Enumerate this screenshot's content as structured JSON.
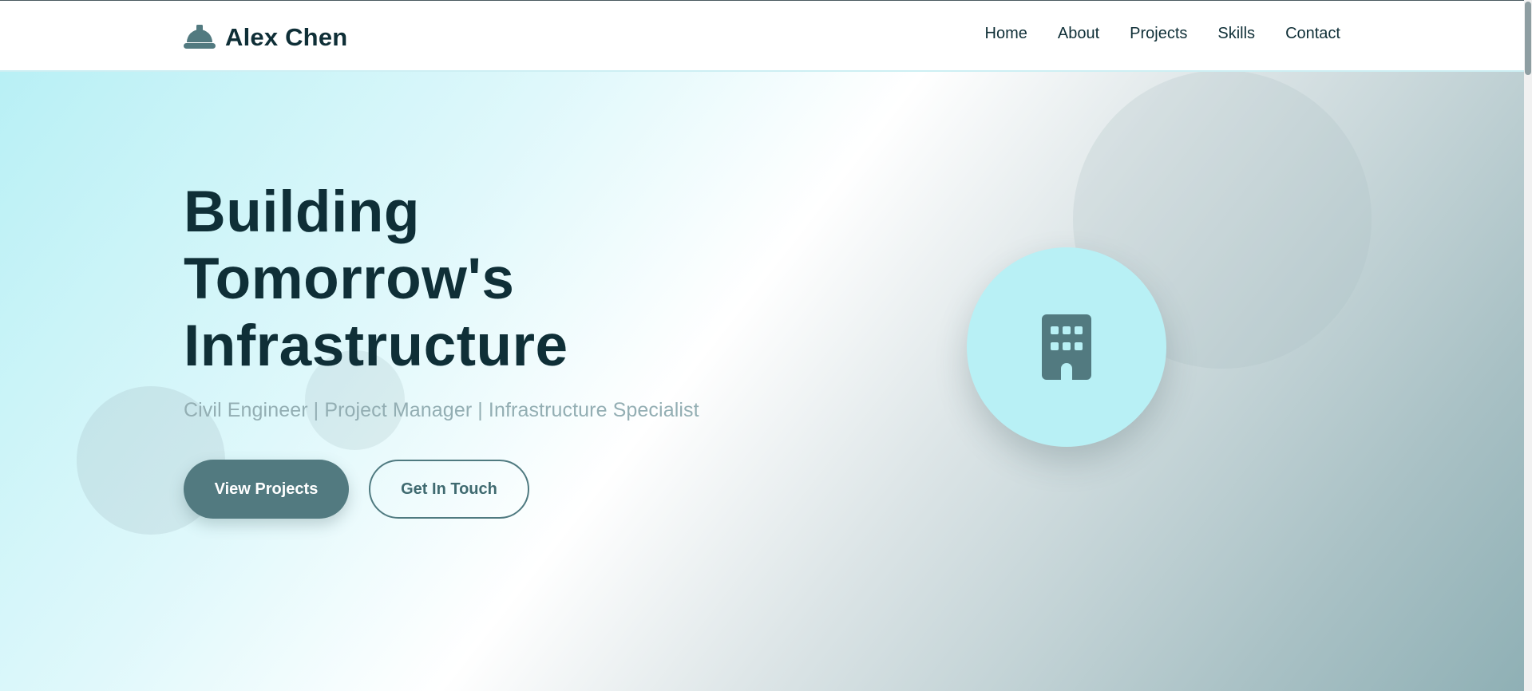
{
  "brand": {
    "name": "Alex Chen",
    "icon": "hard-hat-icon"
  },
  "nav": {
    "items": [
      {
        "label": "Home"
      },
      {
        "label": "About"
      },
      {
        "label": "Projects"
      },
      {
        "label": "Skills"
      },
      {
        "label": "Contact"
      }
    ]
  },
  "hero": {
    "title_lines": [
      "Building",
      "Tomorrow's",
      "Infrastructure"
    ],
    "subtitle": "Civil Engineer | Project Manager | Infrastructure Specialist",
    "primary_button": "View Projects",
    "secondary_button": "Get In Touch",
    "badge_icon": "building-icon"
  },
  "colors": {
    "primary": "#527a80",
    "text_dark": "#0f2f37",
    "accent_light": "#b8f0f5",
    "subtitle": "#93aeb3"
  }
}
